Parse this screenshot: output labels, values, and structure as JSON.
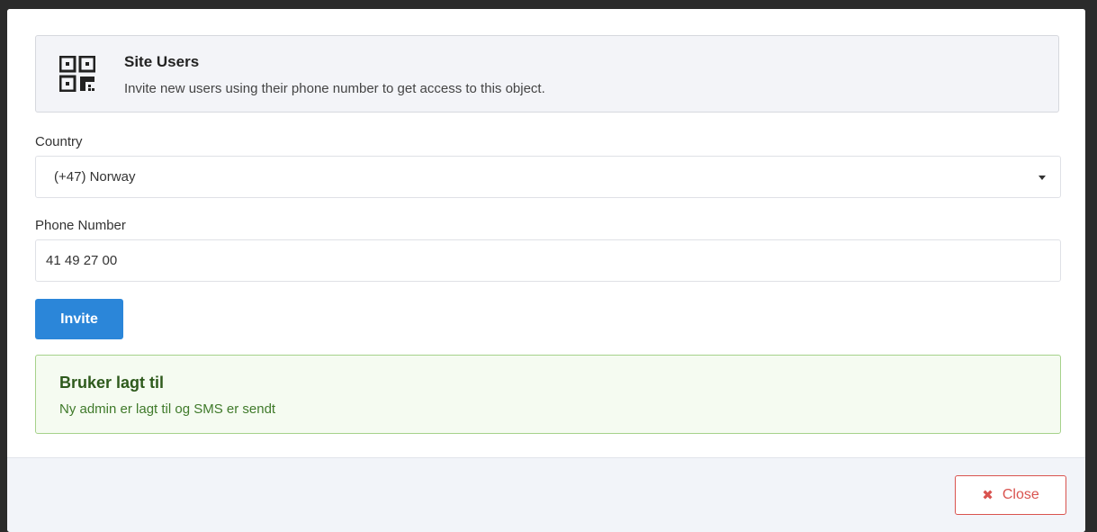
{
  "header": {
    "icon": "qr-code-icon",
    "title": "Site Users",
    "description": "Invite new users using their phone number to get access to this object."
  },
  "form": {
    "country_label": "Country",
    "country_value": "(+47) Norway",
    "phone_label": "Phone Number",
    "phone_value": "41 49 27 00",
    "invite_label": "Invite"
  },
  "alert": {
    "title": "Bruker lagt til",
    "message": "Ny admin er lagt til og SMS er sendt"
  },
  "footer": {
    "close_icon": "✖",
    "close_label": "Close"
  },
  "colors": {
    "primary": "#2b86d9",
    "success_border": "#a6d28b",
    "success_text": "#2e5a1c",
    "danger": "#d9534f"
  }
}
